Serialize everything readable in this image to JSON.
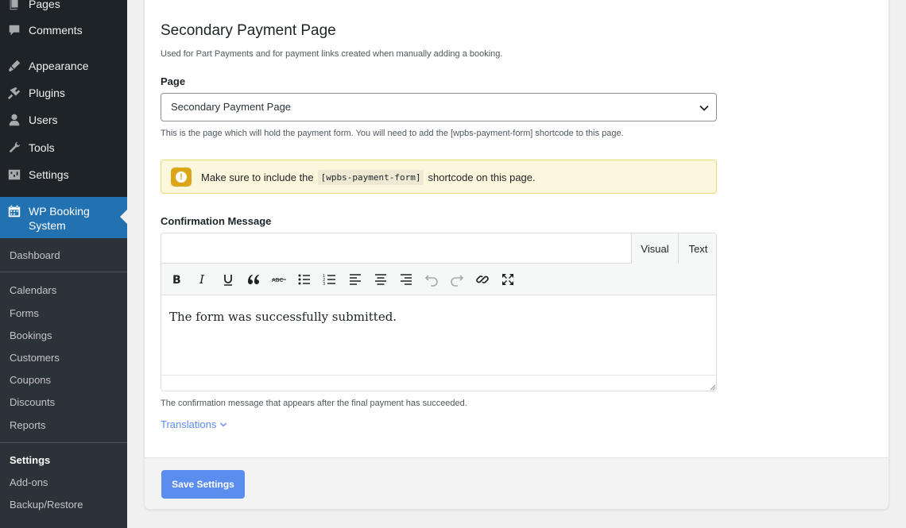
{
  "sidebar": {
    "items": [
      {
        "label": "Pages",
        "icon": "pages-icon"
      },
      {
        "label": "Comments",
        "icon": "comments-icon"
      },
      {
        "label": "Appearance",
        "icon": "appearance-icon"
      },
      {
        "label": "Plugins",
        "icon": "plugins-icon"
      },
      {
        "label": "Users",
        "icon": "users-icon"
      },
      {
        "label": "Tools",
        "icon": "tools-icon"
      },
      {
        "label": "Settings",
        "icon": "settings-icon"
      }
    ],
    "current": {
      "label": "WP Booking System",
      "icon": "calendar-icon"
    },
    "submenu": {
      "dashboard": "Dashboard",
      "calendars": "Calendars",
      "forms": "Forms",
      "bookings": "Bookings",
      "customers": "Customers",
      "coupons": "Coupons",
      "discounts": "Discounts",
      "reports": "Reports",
      "settings": "Settings",
      "addons": "Add-ons",
      "backup": "Backup/Restore"
    }
  },
  "section": {
    "title": "Secondary Payment Page",
    "description": "Used for Part Payments and for payment links created when manually adding a booking."
  },
  "page_field": {
    "label": "Page",
    "value": "Secondary Payment Page",
    "help": "This is the page which will hold the payment form. You will need to add the [wpbs-payment-form] shortcode to this page."
  },
  "notice": {
    "before": "Make sure to include the",
    "code": "[wpbs-payment-form]",
    "after": "shortcode on this page.",
    "accent": "#dba617"
  },
  "confirmation": {
    "label": "Confirmation Message",
    "tab_visual": "Visual",
    "tab_text": "Text",
    "toolbar": [
      "bold-icon",
      "italic-icon",
      "underline-icon",
      "blockquote-icon",
      "strikethrough-icon",
      "bullet-list-icon",
      "numbered-list-icon",
      "align-left-icon",
      "align-center-icon",
      "align-right-icon",
      "undo-icon",
      "redo-icon",
      "link-icon",
      "fullscreen-icon"
    ],
    "content": "The form was successfully submitted.",
    "help": "The confirmation message that appears after the final payment has succeeded."
  },
  "translations_label": "Translations",
  "save_label": "Save Settings",
  "colors": {
    "sidebar": "#1d2327",
    "active": "#2271b1",
    "primary_button": "#5b8def"
  }
}
